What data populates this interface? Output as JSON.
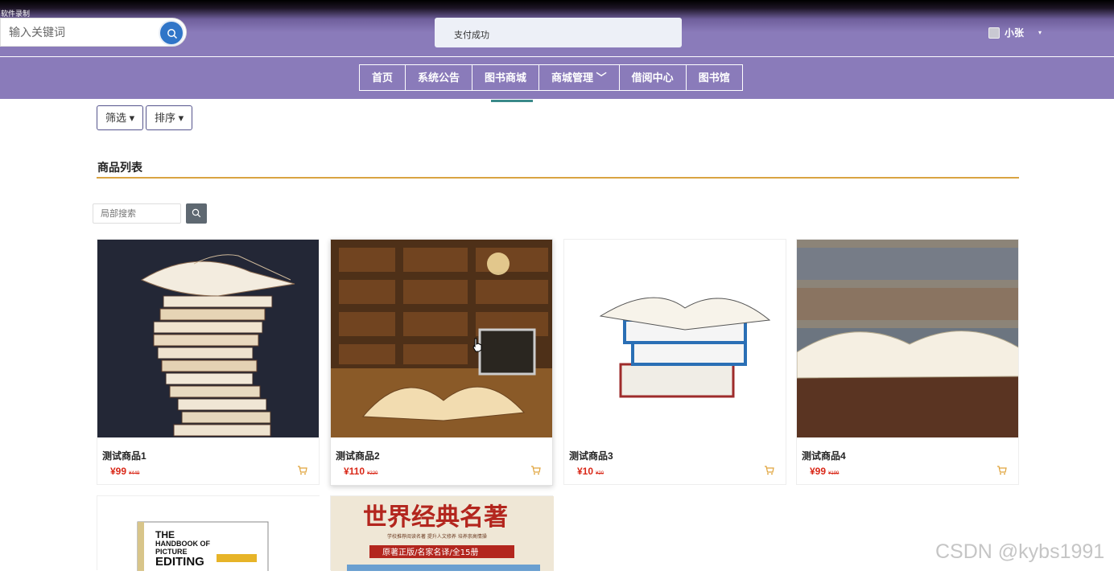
{
  "recorder_label": "软件录制",
  "header": {
    "search_placeholder": "输入关键词",
    "toast": "支付成功",
    "user_name": "小张",
    "user_caret": "▾"
  },
  "nav": {
    "items": [
      {
        "label": "首页"
      },
      {
        "label": "系统公告"
      },
      {
        "label": "图书商城"
      },
      {
        "label": "商城管理 ﹀"
      },
      {
        "label": "借阅中心"
      },
      {
        "label": "图书馆"
      }
    ],
    "active_index": 2
  },
  "toolbar": {
    "filter_label": "筛选 ▾",
    "sort_label": "排序 ▾"
  },
  "section": {
    "title": "商品列表",
    "local_search_placeholder": "局部搜索"
  },
  "products": [
    {
      "name": "测试商品1",
      "price": "¥99",
      "old_price": "¥449"
    },
    {
      "name": "测试商品2",
      "price": "¥110",
      "old_price": "¥220"
    },
    {
      "name": "测试商品3",
      "price": "¥10",
      "old_price": "¥20"
    },
    {
      "name": "测试商品4",
      "price": "¥99",
      "old_price": "¥199"
    }
  ],
  "partial_products": [
    {
      "cover_text": [
        "THE",
        "HANDBOOK OF",
        "PICTURE",
        "EDITING"
      ]
    },
    {
      "cover_title": "世界经典名著",
      "cover_sub": "学校推荐阅读名著 提升人文修养 培养崇高情操",
      "cover_banner": "原著正版/名家名译/全15册"
    }
  ],
  "watermark": "CSDN @kybs1991",
  "colors": {
    "header_purple": "#8a7bba",
    "accent_gold": "#d9a442",
    "price_red": "#d92818",
    "search_blue": "#2f75c8"
  }
}
